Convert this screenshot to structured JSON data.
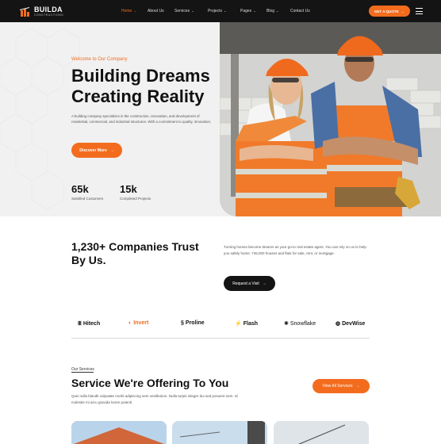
{
  "nav": {
    "logo_name": "BUILDA",
    "logo_tag": "CONSTRUCTIONS",
    "items": [
      {
        "label": "Home",
        "chevron": true,
        "active": true
      },
      {
        "label": "About Us",
        "chevron": false,
        "active": false
      },
      {
        "label": "Services",
        "chevron": true,
        "active": false
      },
      {
        "label": "Projects",
        "chevron": true,
        "active": false
      },
      {
        "label": "Pages",
        "chevron": true,
        "active": false
      },
      {
        "label": "Blog",
        "chevron": true,
        "active": false
      },
      {
        "label": "Contact Us",
        "chevron": false,
        "active": false
      }
    ],
    "cta": "GET A QUOTE"
  },
  "hero": {
    "welcome": "Welcome to Our  Company",
    "headline_1": "Building Dreams",
    "headline_2": "Creating Reality",
    "description": "A building company specializes in the construction, renovation, and development of residential, commercial, and industrial structures. With a commitment to quality, innovation,",
    "button": "Discover More",
    "stats": [
      {
        "value": "65k",
        "label": "Satisfied Customers"
      },
      {
        "value": "15k",
        "label": "Completed Projects"
      }
    ]
  },
  "companies": {
    "title": "1,230+ Companies Trust By Us.",
    "description": "Turning homes become dreams as your go-to real estate agent. You can rely on us to help you safely home. 745,000 houses and flats for sale, rent, or mortgage.",
    "button": "Request a Visit"
  },
  "brands": [
    "Hitech",
    "Invert",
    "Proline",
    "Flash",
    "Snowflake",
    "DevWise"
  ],
  "services": {
    "kicker": "Our Services",
    "title": "Service We're Offering To You",
    "description": "Quis nulla blandit vulputate morbi adipiscing sem vestibulum. Nulla turpis integer dui sed posuere sem. Id molestie mi arcu gravida lorem potenti.",
    "button": "View All Services"
  },
  "colors": {
    "accent": "#f36c1e",
    "dark": "#141414",
    "hero_bg": "#f1f1f1"
  }
}
